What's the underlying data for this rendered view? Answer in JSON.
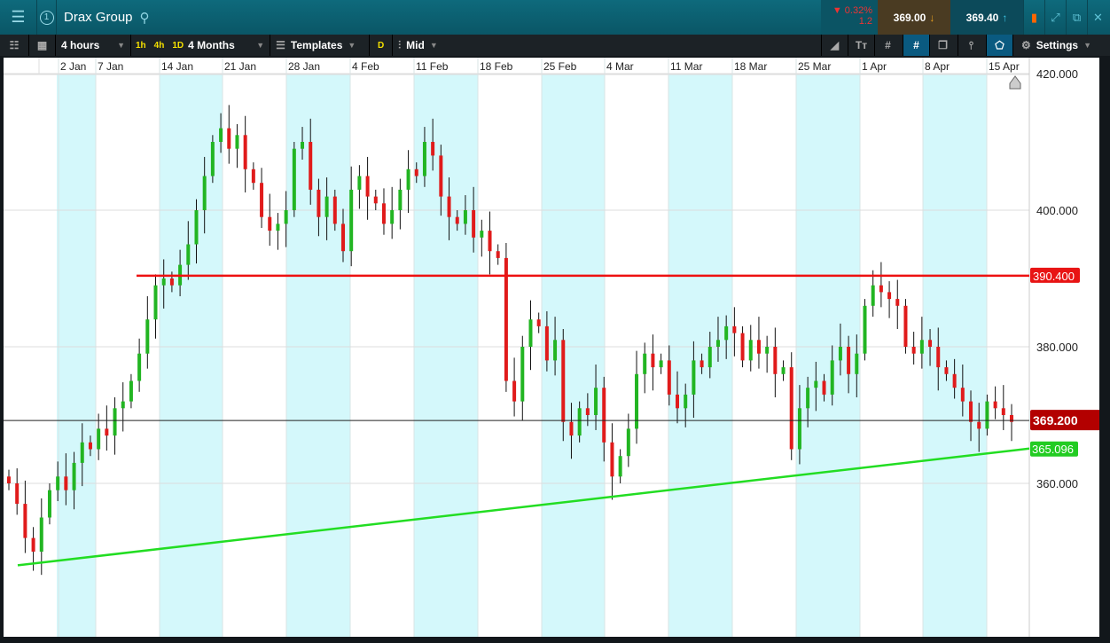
{
  "header": {
    "title": "Drax Group",
    "change_pct": "▼ 0.32%",
    "change_abs": "1.2",
    "sell_price": "369.00",
    "buy_price": "369.40",
    "badge": "1"
  },
  "toolbar": {
    "interval": "4 hours",
    "quick": [
      "1h",
      "4h",
      "1D"
    ],
    "range": "4 Months",
    "templates": "Templates",
    "d": "D",
    "price_type": "Mid",
    "settings": "Settings"
  },
  "colors": {
    "up": "#22b522",
    "down": "#e01b1b",
    "shade": "#d4f8fb",
    "resistance": "#ee1111",
    "support": "#22dd22"
  },
  "chart_data": {
    "type": "candlestick",
    "title": "Drax Group",
    "x_tick_labels": [
      "2 Jan",
      "7 Jan",
      "14 Jan",
      "21 Jan",
      "28 Jan",
      "4 Feb",
      "11 Feb",
      "18 Feb",
      "25 Feb",
      "4 Mar",
      "11 Mar",
      "18 Mar",
      "25 Mar",
      "1 Apr",
      "8 Apr",
      "15 Apr"
    ],
    "y_tick_labels": [
      "420.000",
      "400.000",
      "380.000",
      "360.000"
    ],
    "y_ticks": [
      420,
      400,
      380,
      360
    ],
    "ylim": [
      343,
      422.5
    ],
    "closes": [
      360,
      357,
      352,
      350,
      355,
      359,
      361,
      359,
      363,
      366,
      365,
      368,
      367,
      371,
      372,
      375,
      379,
      384,
      389,
      390,
      389,
      392,
      395,
      400,
      405,
      410,
      412,
      409,
      411,
      406,
      404,
      399,
      397,
      398,
      400,
      409,
      410,
      403,
      399,
      402,
      398,
      394,
      403,
      405,
      402,
      401,
      398,
      400,
      403,
      406,
      405,
      410,
      408,
      402,
      399,
      398,
      400,
      396,
      397,
      394,
      393,
      375,
      372,
      380,
      384,
      383,
      378,
      381,
      369,
      367,
      371,
      370,
      374,
      366,
      361,
      364,
      368,
      376,
      379,
      377,
      378,
      373,
      371,
      373,
      378,
      377,
      380,
      381,
      383,
      382,
      378,
      381,
      379,
      380,
      376,
      377,
      365,
      371,
      374,
      375,
      373,
      378,
      380,
      376,
      379,
      386,
      389,
      388,
      387,
      386,
      380,
      379,
      381,
      380,
      377,
      376,
      374,
      372,
      369,
      368,
      372,
      371,
      370,
      369
    ],
    "resistance": {
      "value": 390.4,
      "label": "390.400"
    },
    "current": {
      "value": 369.2,
      "label": "369.200"
    },
    "trendline": {
      "start": 348,
      "end": 365.096,
      "label": "365.096"
    }
  }
}
